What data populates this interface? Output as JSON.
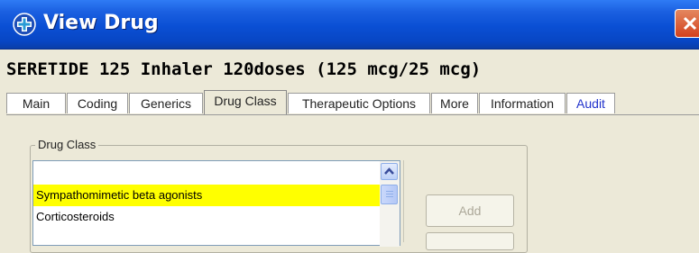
{
  "window": {
    "title": "View Drug",
    "app_icon": "cross-medical-icon",
    "close_icon": "close-icon",
    "colors": {
      "titlebar": "#0a4fd4",
      "close": "#d2411d",
      "face": "#ece9d8"
    }
  },
  "drug": {
    "name": "SERETIDE 125 Inhaler 120doses (125 mcg/25 mcg)"
  },
  "tabs": [
    {
      "label": "Main"
    },
    {
      "label": "Coding"
    },
    {
      "label": "Generics"
    },
    {
      "label": "Drug Class",
      "active": true
    },
    {
      "label": "Therapeutic Options"
    },
    {
      "label": "More"
    },
    {
      "label": "Information"
    },
    {
      "label": "Audit",
      "link": true
    }
  ],
  "drug_class": {
    "group_title": "Drug Class",
    "items": [
      {
        "label": "Sympathomimetic beta agonists",
        "selected": true,
        "highlight": "#ffff00"
      },
      {
        "label": "Corticosteroids",
        "selected": false
      }
    ],
    "add_button": "Add"
  }
}
